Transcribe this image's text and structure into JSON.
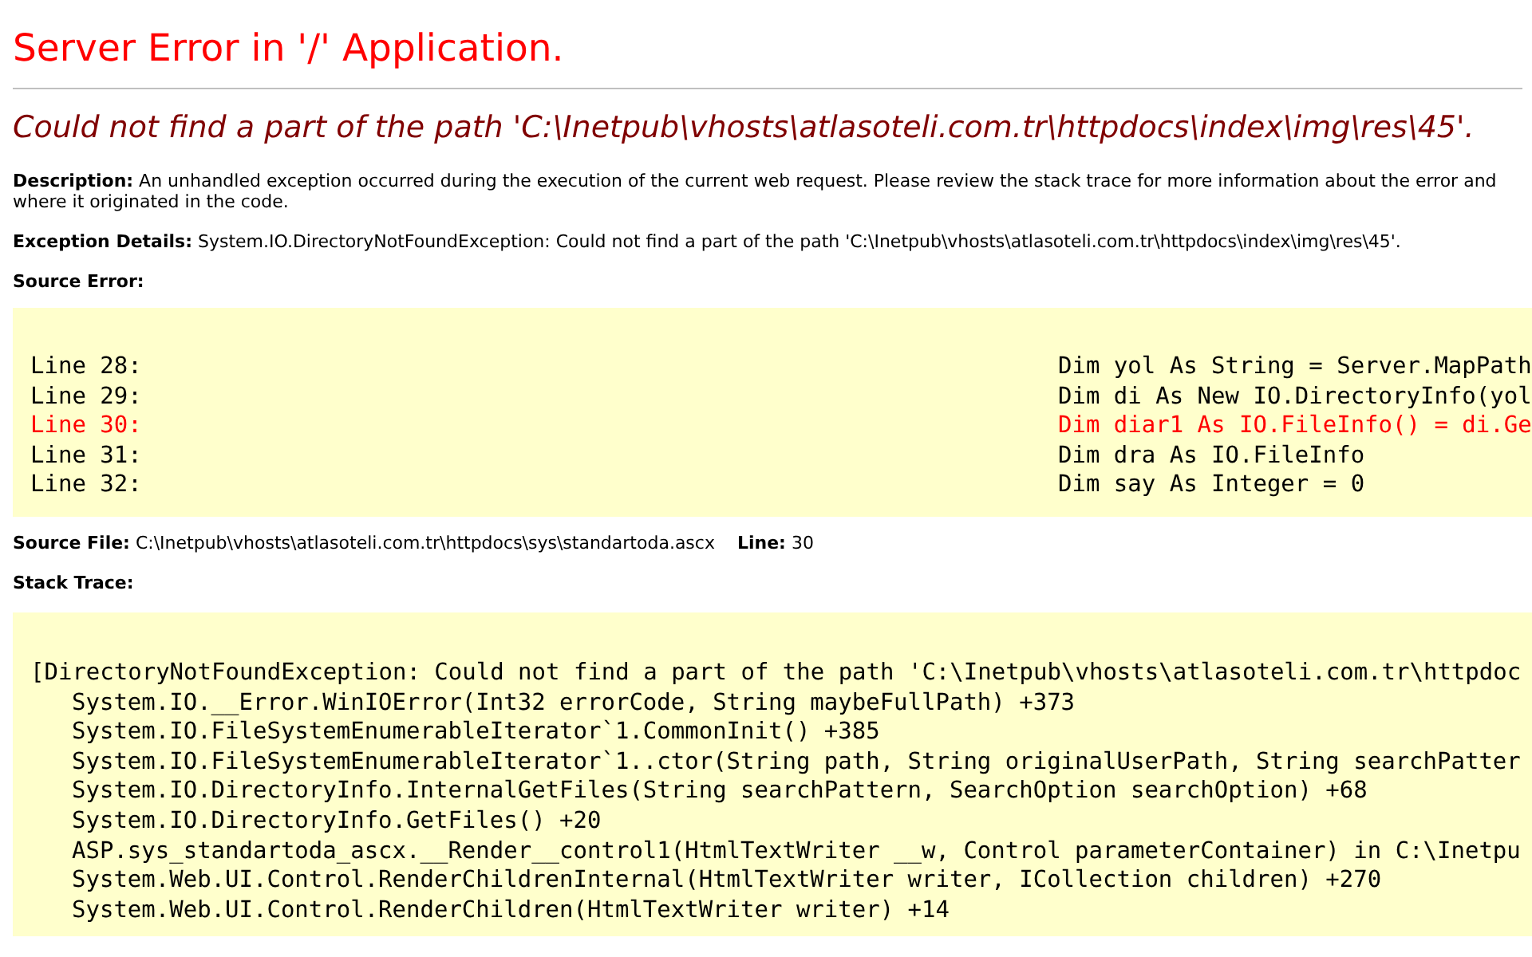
{
  "title": "Server Error in '/' Application.",
  "message": "Could not find a part of the path 'C:\\Inetpub\\vhosts\\atlasoteli.com.tr\\httpdocs\\index\\img\\res\\45'.",
  "description": {
    "label": "Description:",
    "text": "An unhandled exception occurred during the execution of the current web request. Please review the stack trace for more information about the error and where it originated in the code."
  },
  "exception_details": {
    "label": "Exception Details:",
    "text": "System.IO.DirectoryNotFoundException: Could not find a part of the path 'C:\\Inetpub\\vhosts\\atlasoteli.com.tr\\httpdocs\\index\\img\\res\\45'."
  },
  "source_error": {
    "label": "Source Error:",
    "lines": [
      {
        "number": "Line 28:",
        "code": "Dim yol As String = Server.MapPath",
        "error": false
      },
      {
        "number": "Line 29:",
        "code": "Dim di As New IO.DirectoryInfo(yol",
        "error": false
      },
      {
        "number": "Line 30:",
        "code": "Dim diar1 As IO.FileInfo() = di.Ge",
        "error": true
      },
      {
        "number": "Line 31:",
        "code": "Dim dra As IO.FileInfo",
        "error": false
      },
      {
        "number": "Line 32:",
        "code": "Dim say As Integer = 0",
        "error": false
      }
    ]
  },
  "source_file": {
    "label": "Source File:",
    "path": "C:\\Inetpub\\vhosts\\atlasoteli.com.tr\\httpdocs\\sys\\standartoda.ascx",
    "line_label": "Line:",
    "line": "30"
  },
  "stack_trace": {
    "label": "Stack Trace:",
    "lines": [
      {
        "text": "[DirectoryNotFoundException: Could not find a part of the path 'C:\\Inetpub\\vhosts\\atlasoteli.com.tr\\httpdoc",
        "indented": false
      },
      {
        "text": "System.IO.__Error.WinIOError(Int32 errorCode, String maybeFullPath) +373",
        "indented": true
      },
      {
        "text": "System.IO.FileSystemEnumerableIterator`1.CommonInit() +385",
        "indented": true
      },
      {
        "text": "System.IO.FileSystemEnumerableIterator`1..ctor(String path, String originalUserPath, String searchPatter",
        "indented": true
      },
      {
        "text": "System.IO.DirectoryInfo.InternalGetFiles(String searchPattern, SearchOption searchOption) +68",
        "indented": true
      },
      {
        "text": "System.IO.DirectoryInfo.GetFiles() +20",
        "indented": true
      },
      {
        "text": "ASP.sys_standartoda_ascx.__Render__control1(HtmlTextWriter __w, Control parameterContainer) in C:\\Inetpu",
        "indented": true
      },
      {
        "text": "System.Web.UI.Control.RenderChildrenInternal(HtmlTextWriter writer, ICollection children) +270",
        "indented": true
      },
      {
        "text": "System.Web.UI.Control.RenderChildren(HtmlTextWriter writer) +14",
        "indented": true
      }
    ]
  }
}
